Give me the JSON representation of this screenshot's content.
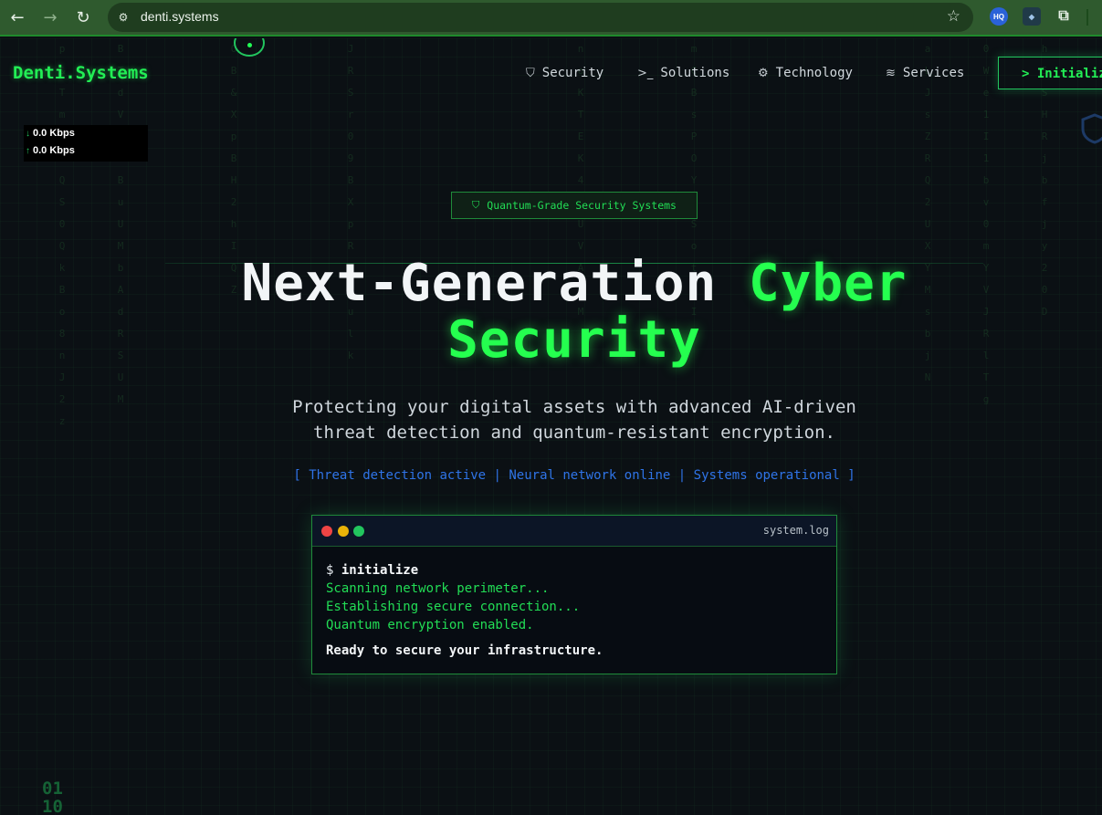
{
  "browser": {
    "url": "denti.systems",
    "back_icon": "←",
    "forward_icon": "→",
    "reload_icon": "↻",
    "site_info_icon": "⚙",
    "star_icon": "☆",
    "extension_1_label": "HQ",
    "extension_2_label": "◆",
    "extensions_icon": "⧉"
  },
  "header": {
    "brand": "Denti.Systems",
    "nav": [
      {
        "label": "Security",
        "icon": "shield-icon",
        "glyph": "⛉"
      },
      {
        "label": "Solutions",
        "icon": "terminal-icon",
        "glyph": ">_"
      },
      {
        "label": "Technology",
        "icon": "cpu-icon",
        "glyph": "⚙"
      },
      {
        "label": "Services",
        "icon": "database-icon",
        "glyph": "≋"
      }
    ],
    "cta_label": "> Initialize"
  },
  "speed_widget": {
    "download": "0.0 Kbps",
    "upload": "0.0 Kbps",
    "down_arrow": "↓",
    "up_arrow": "↑"
  },
  "hero": {
    "badge_icon": "⛉",
    "badge_label": "Quantum-Grade Security Systems",
    "headline_white": "Next-Generation",
    "headline_green_1": "Cyber",
    "headline_green_2": "Security",
    "subtitle_line_1": "Protecting your digital assets with advanced AI-driven",
    "subtitle_line_2": "threat detection and quantum-resistant encryption.",
    "status_line": "[ Threat detection active | Neural network online | Systems operational ]"
  },
  "terminal": {
    "filename": "system.log",
    "prompt": "$",
    "command": "initialize",
    "output": [
      "Scanning network perimeter...",
      "Establishing secure connection...",
      "Quantum encryption enabled."
    ],
    "ready": "Ready to secure your infrastructure."
  },
  "decor": {
    "binary_1": "01",
    "binary_2": "10"
  },
  "colors": {
    "accent_green": "#22ee55",
    "status_blue": "#2f74e8",
    "background": "#0b1014",
    "chrome_green": "#2f5a2e"
  }
}
